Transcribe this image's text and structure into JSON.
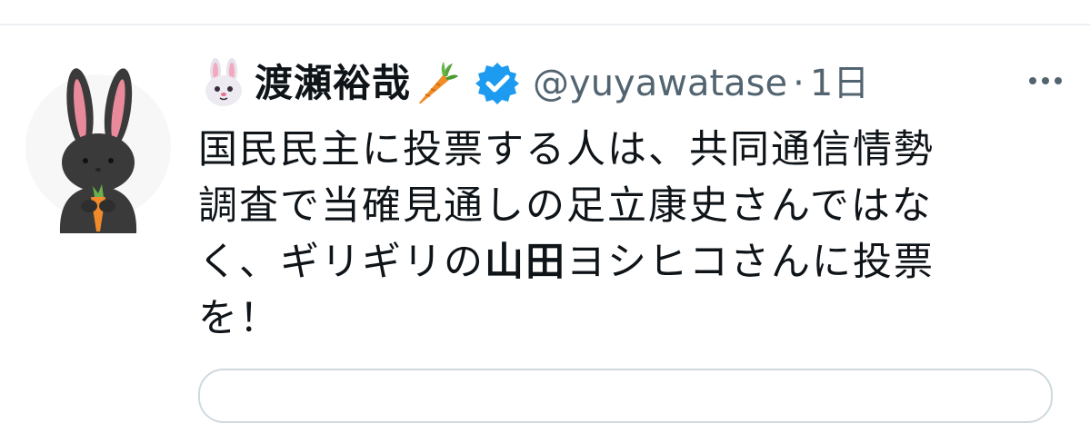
{
  "tweet": {
    "author": {
      "display_name": "渡瀬裕哉",
      "name_prefix_emoji": "rabbit-face-icon",
      "name_suffix_emoji": "carrot-icon",
      "verified": true,
      "handle": "@yuyawatase",
      "avatar": "black-rabbit-holding-carrot-avatar"
    },
    "separator": "·",
    "time": "1日",
    "more_icon": "more-horizontal-icon",
    "text_lines": {
      "line1": "国民民主に投票する人は、共同通信情勢",
      "line2": "調査で当確見通しの足立康史さんではな",
      "line3_before": "く、ギリギリの",
      "line3_bold": "山田",
      "line3_after": "ヨシヒコさんに投票",
      "line4": "を！"
    }
  },
  "colors": {
    "text_primary": "#0f1419",
    "text_secondary": "#536471",
    "verified_blue": "#1d9bf0",
    "divider": "#eceff1",
    "card_border": "#cfd9de"
  }
}
